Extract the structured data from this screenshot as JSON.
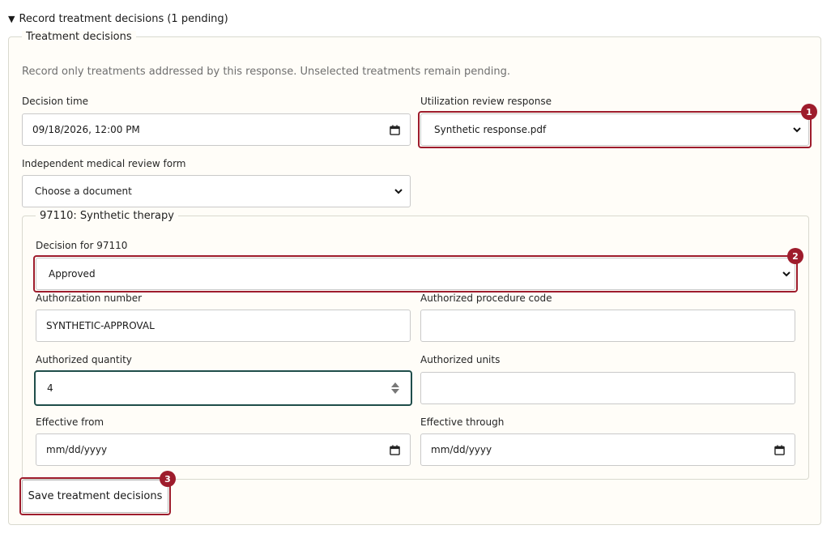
{
  "section": {
    "summary": "Record treatment decisions (1 pending)",
    "legend": "Treatment decisions",
    "note": "Record only treatments addressed by this response. Unselected treatments remain pending."
  },
  "decision_time": {
    "label": "Decision time",
    "value": "09/18/2026, 12:00 PM"
  },
  "ur_response": {
    "label": "Utilization review response",
    "selected": "Synthetic response.pdf",
    "badge": "1"
  },
  "imr_form": {
    "label": "Independent medical review form",
    "selected": "Choose a document"
  },
  "treatment": {
    "legend": "97110: Synthetic therapy",
    "decision_label": "Decision for 97110",
    "decision_selected": "Approved",
    "decision_badge": "2",
    "auth_number_label": "Authorization number",
    "auth_number_value": "SYNTHETIC-APPROVAL",
    "auth_code_label": "Authorized procedure code",
    "auth_code_value": "",
    "auth_qty_label": "Authorized quantity",
    "auth_qty_value": "4",
    "auth_units_label": "Authorized units",
    "auth_units_value": "",
    "effective_from_label": "Effective from",
    "effective_from_value": "mm/dd/yyyy",
    "effective_through_label": "Effective through",
    "effective_through_value": "mm/dd/yyyy"
  },
  "save": {
    "label": "Save treatment decisions",
    "badge": "3"
  },
  "colors": {
    "highlight": "#9e1c2c",
    "focus": "#1f4d4a",
    "panel_bg": "#fffdf8"
  }
}
